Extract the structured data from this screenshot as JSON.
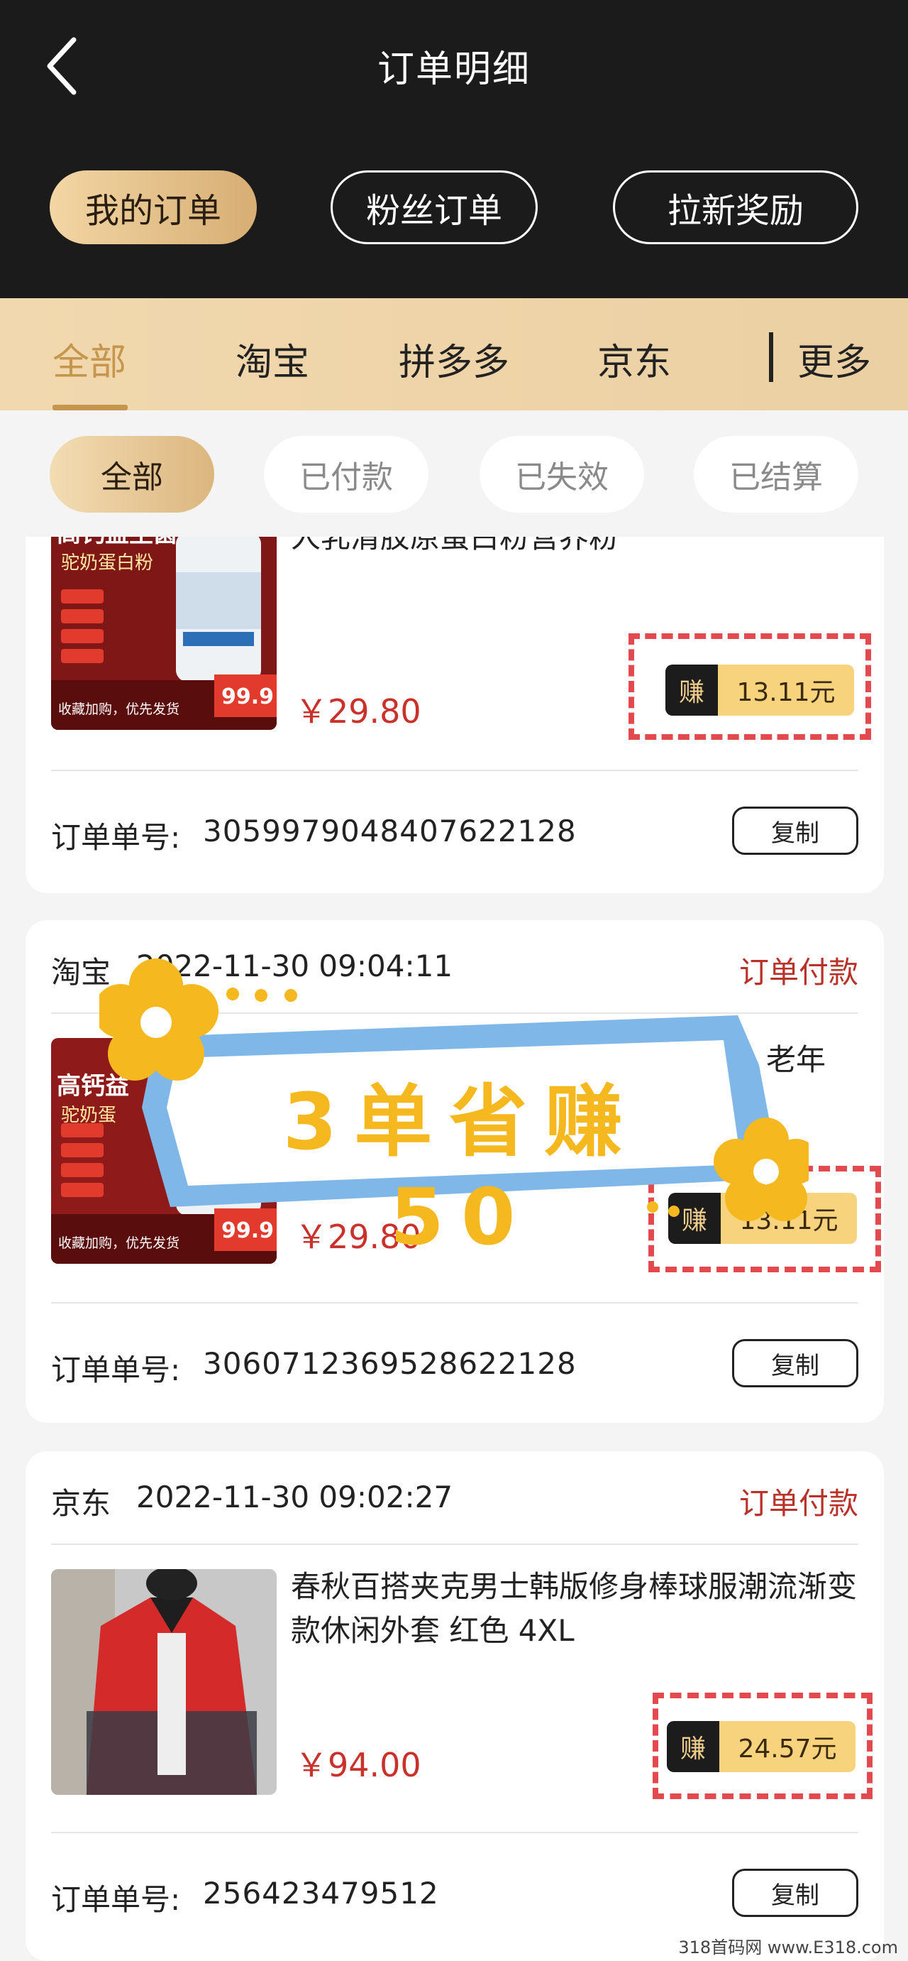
{
  "header": {
    "title": "订单明细",
    "segments": [
      "我的订单",
      "粉丝订单",
      "拉新奖励"
    ]
  },
  "platform_tabs": [
    "全部",
    "淘宝",
    "拼多多",
    "京东",
    "更多"
  ],
  "status_chips": [
    "全部",
    "已付款",
    "已失效",
    "已结算"
  ],
  "orders": [
    {
      "product_name": "蛋白粉奶粉蛋白质粉儿童青少年中老年人乳清胶原蛋白粉营养粉",
      "product_name_visible": "人乳清胶原蛋白粉营养粉",
      "thumb_title": "高钙益生菌",
      "thumb_sub": "驼奶蛋白粉",
      "thumb_footer": "收藏加购，优先发货",
      "thumb_price": "99.9",
      "price": "￥29.80",
      "earn_label": "赚",
      "earn_value": "13.11元",
      "order_no_label": "订单单号:",
      "order_no": "3059979048407622128",
      "copy_label": "复制"
    },
    {
      "platform": "淘宝",
      "time": "2022-11-30 09:04:11",
      "status": "订单付款",
      "product_name_visible": "老年",
      "thumb_title": "高钙益",
      "thumb_sub": "驼奶蛋",
      "thumb_footer": "收藏加购，优先发货",
      "thumb_price": "99.9",
      "price": "￥29.80",
      "earn_label": "赚",
      "earn_value": "13.11元",
      "order_no_label": "订单单号:",
      "order_no": "3060712369528622128",
      "copy_label": "复制"
    },
    {
      "platform": "京东",
      "time": "2022-11-30 09:02:27",
      "status": "订单付款",
      "product_name": "春秋百搭夹克男士韩版修身棒球服潮流渐变款休闲外套 红色 4XL",
      "price": "￥94.00",
      "earn_label": "赚",
      "earn_value": "24.57元",
      "order_no_label": "订单单号:",
      "order_no": "256423479512",
      "copy_label": "复制"
    }
  ],
  "promo_banner": {
    "text": "3单省赚50"
  },
  "watermark": "318首码网 www.E318.com",
  "colors": {
    "header_bg": "#1b1b1b",
    "gold": "#d7ae74",
    "status_red": "#b8322a",
    "price_red": "#c9322a",
    "earn_yellow": "#f7d37d",
    "dash_red": "#e24a4f",
    "promo_blue": "#7fb7e8",
    "promo_yellow": "#f5b81f"
  },
  "icons": {
    "back": "chevron-left-icon",
    "flower": "flower-icon"
  }
}
